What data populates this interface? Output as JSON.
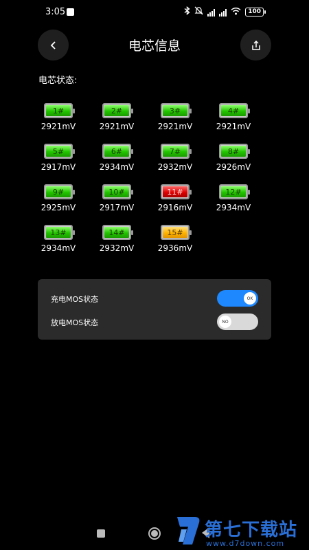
{
  "status_bar": {
    "time": "3:05",
    "icons": [
      "notification-square-icon",
      "bluetooth-icon",
      "mute-icon",
      "signal-icon",
      "signal-icon",
      "wifi-icon",
      "battery-icon"
    ],
    "battery_level": "100"
  },
  "header": {
    "title": "电芯信息",
    "back_icon": "chevron-left-icon",
    "share_icon": "share-icon"
  },
  "cells_section": {
    "label": "电芯状态:",
    "cells": [
      {
        "label": "1#",
        "voltage": "2921mV",
        "status": "normal"
      },
      {
        "label": "2#",
        "voltage": "2921mV",
        "status": "normal"
      },
      {
        "label": "3#",
        "voltage": "2921mV",
        "status": "normal"
      },
      {
        "label": "4#",
        "voltage": "2921mV",
        "status": "normal"
      },
      {
        "label": "5#",
        "voltage": "2917mV",
        "status": "normal"
      },
      {
        "label": "6#",
        "voltage": "2934mV",
        "status": "normal"
      },
      {
        "label": "7#",
        "voltage": "2932mV",
        "status": "normal"
      },
      {
        "label": "8#",
        "voltage": "2926mV",
        "status": "normal"
      },
      {
        "label": "9#",
        "voltage": "2925mV",
        "status": "normal"
      },
      {
        "label": "10#",
        "voltage": "2917mV",
        "status": "normal"
      },
      {
        "label": "11#",
        "voltage": "2916mV",
        "status": "low"
      },
      {
        "label": "12#",
        "voltage": "2934mV",
        "status": "normal"
      },
      {
        "label": "13#",
        "voltage": "2934mV",
        "status": "normal"
      },
      {
        "label": "14#",
        "voltage": "2932mV",
        "status": "normal"
      },
      {
        "label": "15#",
        "voltage": "2936mV",
        "status": "high"
      }
    ],
    "colors": {
      "normal": "#23c400",
      "low": "#e00000",
      "high": "#ffb400"
    }
  },
  "mos": {
    "charge": {
      "label": "充电MOS状态",
      "state_text": "OK",
      "on": true
    },
    "discharge": {
      "label": "放电MOS状态",
      "state_text": "NO",
      "on": false
    },
    "accent": "#1e88ff"
  },
  "nav_bar": {
    "icons": [
      "recents-square-icon",
      "home-circle-icon",
      "back-triangle-icon"
    ]
  },
  "watermark": {
    "text": "第七下载站",
    "url": "www.d7down.com",
    "color": "#2a6fd6"
  }
}
